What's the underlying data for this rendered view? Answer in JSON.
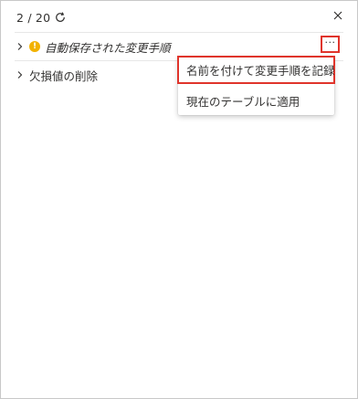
{
  "header": {
    "counter": "2 / 20"
  },
  "steps": [
    {
      "label": "自動保存された変更手順",
      "italic": true,
      "warning": "!"
    },
    {
      "label": "欠損値の削除",
      "italic": false
    }
  ],
  "more_button": {
    "label": "···"
  },
  "context_menu": {
    "items": [
      {
        "label": "名前を付けて変更手順を記録",
        "highlighted": true
      },
      {
        "label": "現在のテーブルに適用",
        "highlighted": false
      }
    ]
  },
  "colors": {
    "warning": "#f2b200",
    "highlight": "#e0342b",
    "border": "#c8c8c8",
    "text": "#323130"
  }
}
